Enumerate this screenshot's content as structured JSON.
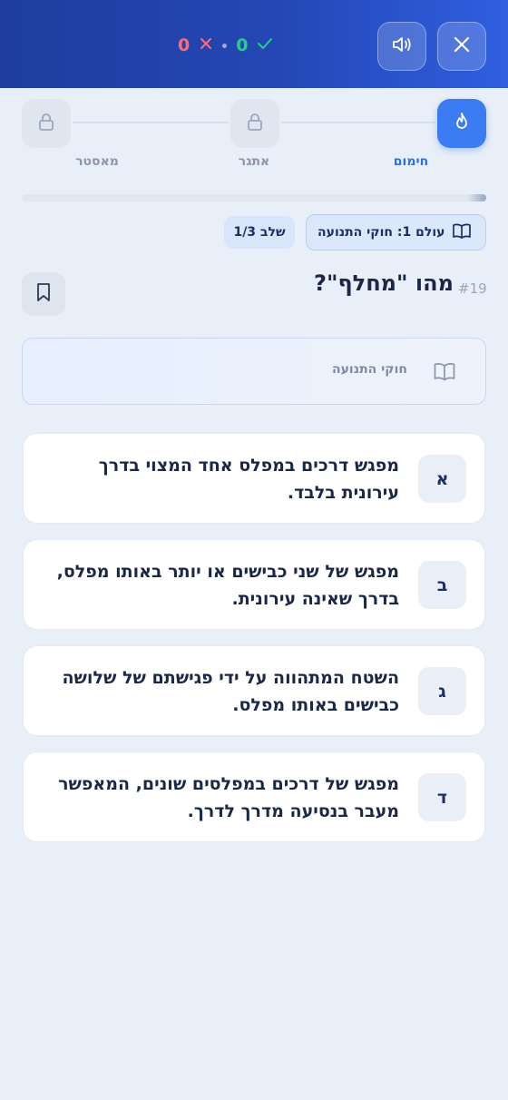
{
  "header": {
    "wrong_count": "0",
    "correct_count": "0",
    "colors": {
      "bg_start": "#1e3d9e",
      "bg_end": "#2f5fe0",
      "wrong": "#ff6b72",
      "correct": "#21d18b"
    },
    "icons": [
      "close-icon",
      "speaker-icon",
      "x-mark-icon",
      "check-icon"
    ]
  },
  "levels": [
    {
      "label": "מאסטר",
      "state": "locked",
      "icon": "lock-icon"
    },
    {
      "label": "אתגר",
      "state": "locked",
      "icon": "lock-icon"
    },
    {
      "label": "חימום",
      "state": "active",
      "icon": "flame-icon"
    }
  ],
  "progress": {
    "value": 0.03
  },
  "badges": {
    "world": "עולם 1: חוקי התנועה",
    "step": "שלב 1/3"
  },
  "question": {
    "number": "#19",
    "title": "מהו \"מחלף\"?",
    "topic": "חוקי התנועה"
  },
  "answers": [
    {
      "letter": "א",
      "text": "מפגש דרכים במפלס אחד המצוי בדרך עירונית בלבד."
    },
    {
      "letter": "ב",
      "text": "מפגש של שני כבישים או יותר באותו מפלס, בדרך שאינה עירונית."
    },
    {
      "letter": "ג",
      "text": "השטח המתהווה על ידי פגישתם של שלושה כבישים באותו מפלס."
    },
    {
      "letter": "ד",
      "text": "מפגש של דרכים במפלסים שונים, המאפשר מעבר בנסיעה מדרך לדרך."
    }
  ]
}
